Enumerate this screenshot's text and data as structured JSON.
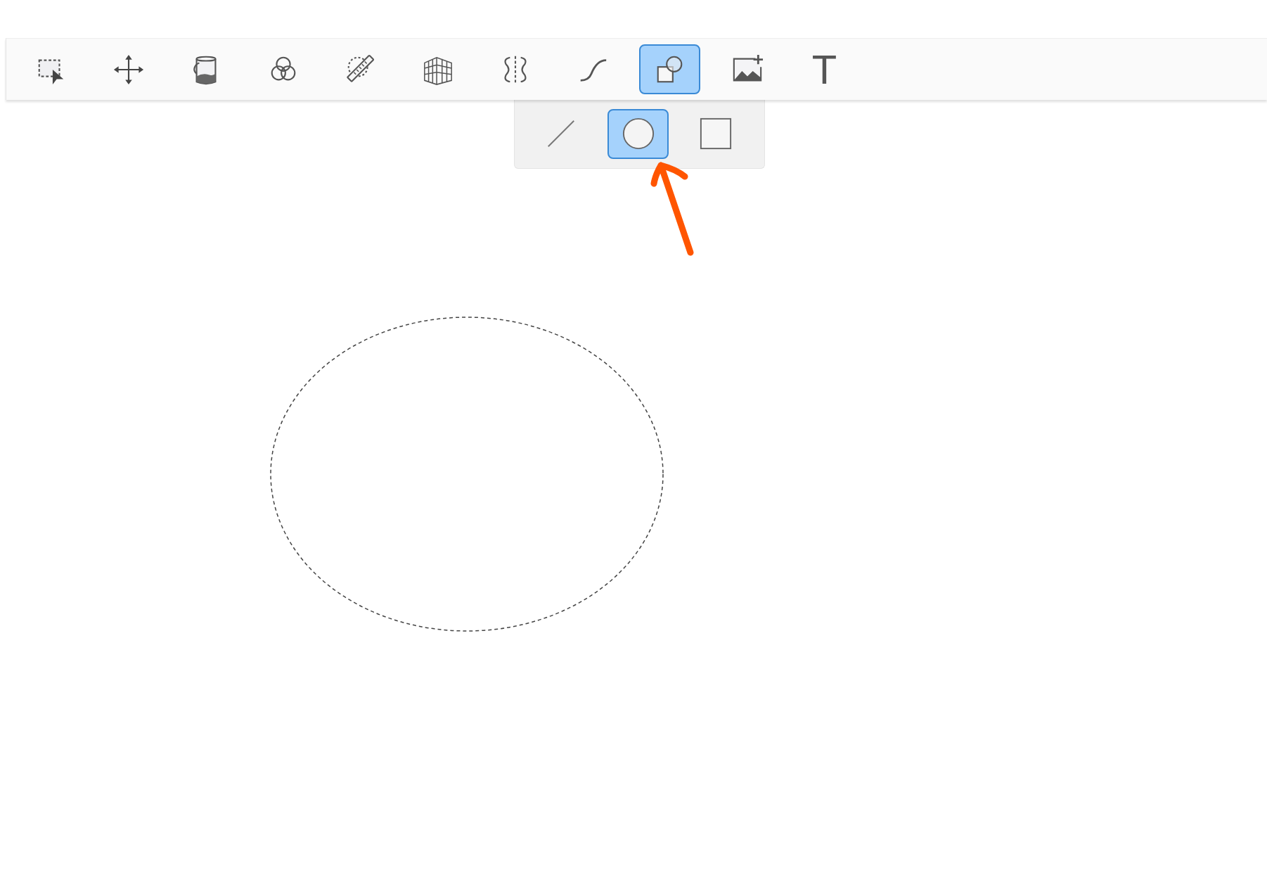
{
  "toolbar": {
    "tools": [
      {
        "kind": "select",
        "selected": false
      },
      {
        "kind": "move",
        "selected": false
      },
      {
        "kind": "fill",
        "selected": false
      },
      {
        "kind": "blend",
        "selected": false
      },
      {
        "kind": "measure",
        "selected": false
      },
      {
        "kind": "perspective",
        "selected": false
      },
      {
        "kind": "mirror",
        "selected": false
      },
      {
        "kind": "curve",
        "selected": false
      },
      {
        "kind": "shapes",
        "selected": true
      },
      {
        "kind": "image",
        "selected": false
      },
      {
        "kind": "text",
        "glyph": "T",
        "selected": false
      }
    ]
  },
  "shape_menu": {
    "options": [
      {
        "kind": "line",
        "selected": false
      },
      {
        "kind": "ellipse",
        "selected": true
      },
      {
        "kind": "rectangle",
        "selected": false
      }
    ]
  }
}
